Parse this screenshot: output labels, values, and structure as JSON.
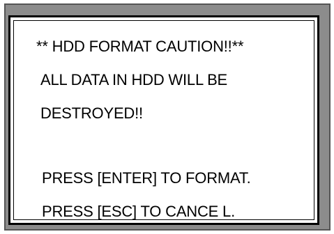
{
  "dialog": {
    "lines": [
      "** HDD FORMAT CAUTION!!**",
      "ALL DATA IN HDD WILL BE",
      "DESTROYED!!",
      "PRESS [ENTER] TO FORMAT.",
      "PRESS [ESC] TO CANCE L."
    ]
  }
}
